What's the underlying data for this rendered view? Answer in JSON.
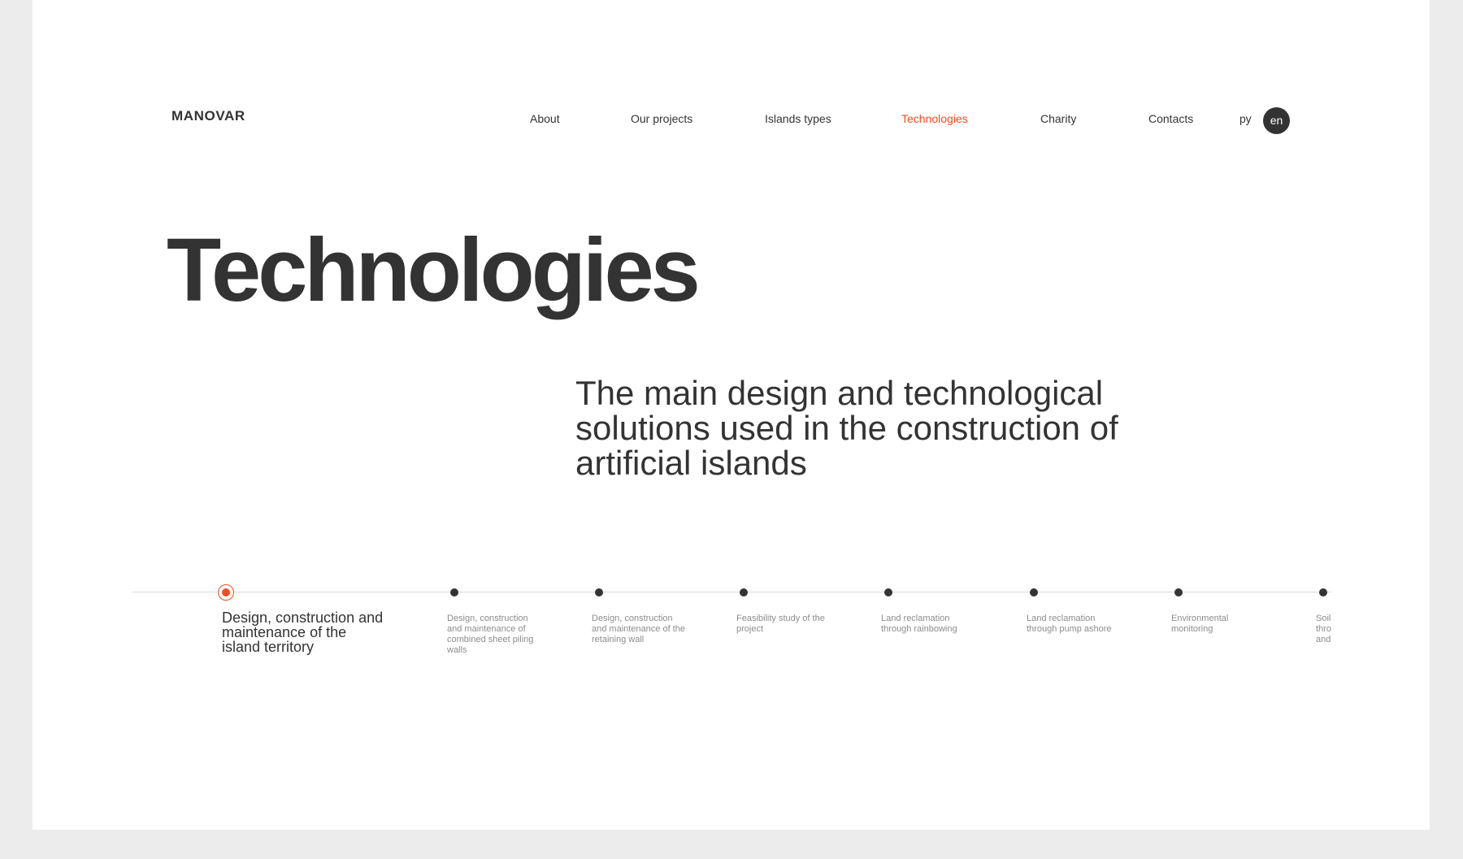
{
  "logo": "MANOVAR",
  "nav": [
    {
      "label": "About",
      "active": false
    },
    {
      "label": "Our projects",
      "active": false
    },
    {
      "label": "Islands types",
      "active": false
    },
    {
      "label": "Technologies",
      "active": true
    },
    {
      "label": "Charity",
      "active": false
    },
    {
      "label": "Contacts",
      "active": false
    }
  ],
  "lang": {
    "ru": "ру",
    "en": "en"
  },
  "page_title": "Technologies",
  "lead_text": "The main design and technological solutions used in the construction of artificial islands",
  "timeline": [
    {
      "label": "Design, construction and maintenance of the island territory",
      "active": true
    },
    {
      "label": "Design, construction and maintenance of combined sheet piling walls",
      "active": false
    },
    {
      "label": "Design, construction and maintenance of the retaining wall",
      "active": false
    },
    {
      "label": "Feasibility study of the project",
      "active": false
    },
    {
      "label": "Land reclamation through rainbowing",
      "active": false
    },
    {
      "label": "Land reclamation through pump ashore",
      "active": false
    },
    {
      "label": "Environmental monitoring",
      "active": false
    },
    {
      "label": "Soil improvement through compaction and vertical horizontal",
      "active": false
    }
  ],
  "colors": {
    "accent": "#f04e23",
    "text": "#333333",
    "muted": "#8c8c8c",
    "background": "#ececec",
    "page": "#ffffff"
  }
}
